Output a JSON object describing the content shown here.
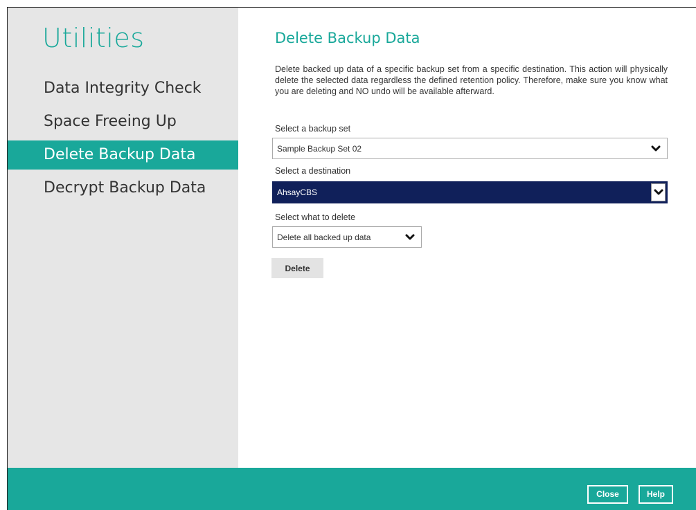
{
  "sidebar": {
    "title": "Utilities",
    "items": [
      {
        "label": "Data Integrity Check",
        "active": false
      },
      {
        "label": "Space Freeing Up",
        "active": false
      },
      {
        "label": "Delete Backup Data",
        "active": true
      },
      {
        "label": "Decrypt Backup Data",
        "active": false
      }
    ]
  },
  "main": {
    "title": "Delete Backup Data",
    "description": "Delete backed up data of a specific backup set from a specific destination. This action will physically delete the selected data regardless the defined retention policy. Therefore, make sure you know what you are deleting and NO undo will be available afterward.",
    "backup_set": {
      "label": "Select a backup set",
      "value": "Sample Backup Set 02"
    },
    "destination": {
      "label": "Select a destination",
      "value": "AhsayCBS"
    },
    "what_to_delete": {
      "label": "Select what to delete",
      "value": "Delete all backed up data"
    },
    "delete_button": "Delete"
  },
  "footer": {
    "close_label": "Close",
    "help_label": "Help"
  },
  "colors": {
    "accent": "#19a89a",
    "selected_dropdown": "#10205a",
    "sidebar_bg": "#e6e6e6"
  }
}
